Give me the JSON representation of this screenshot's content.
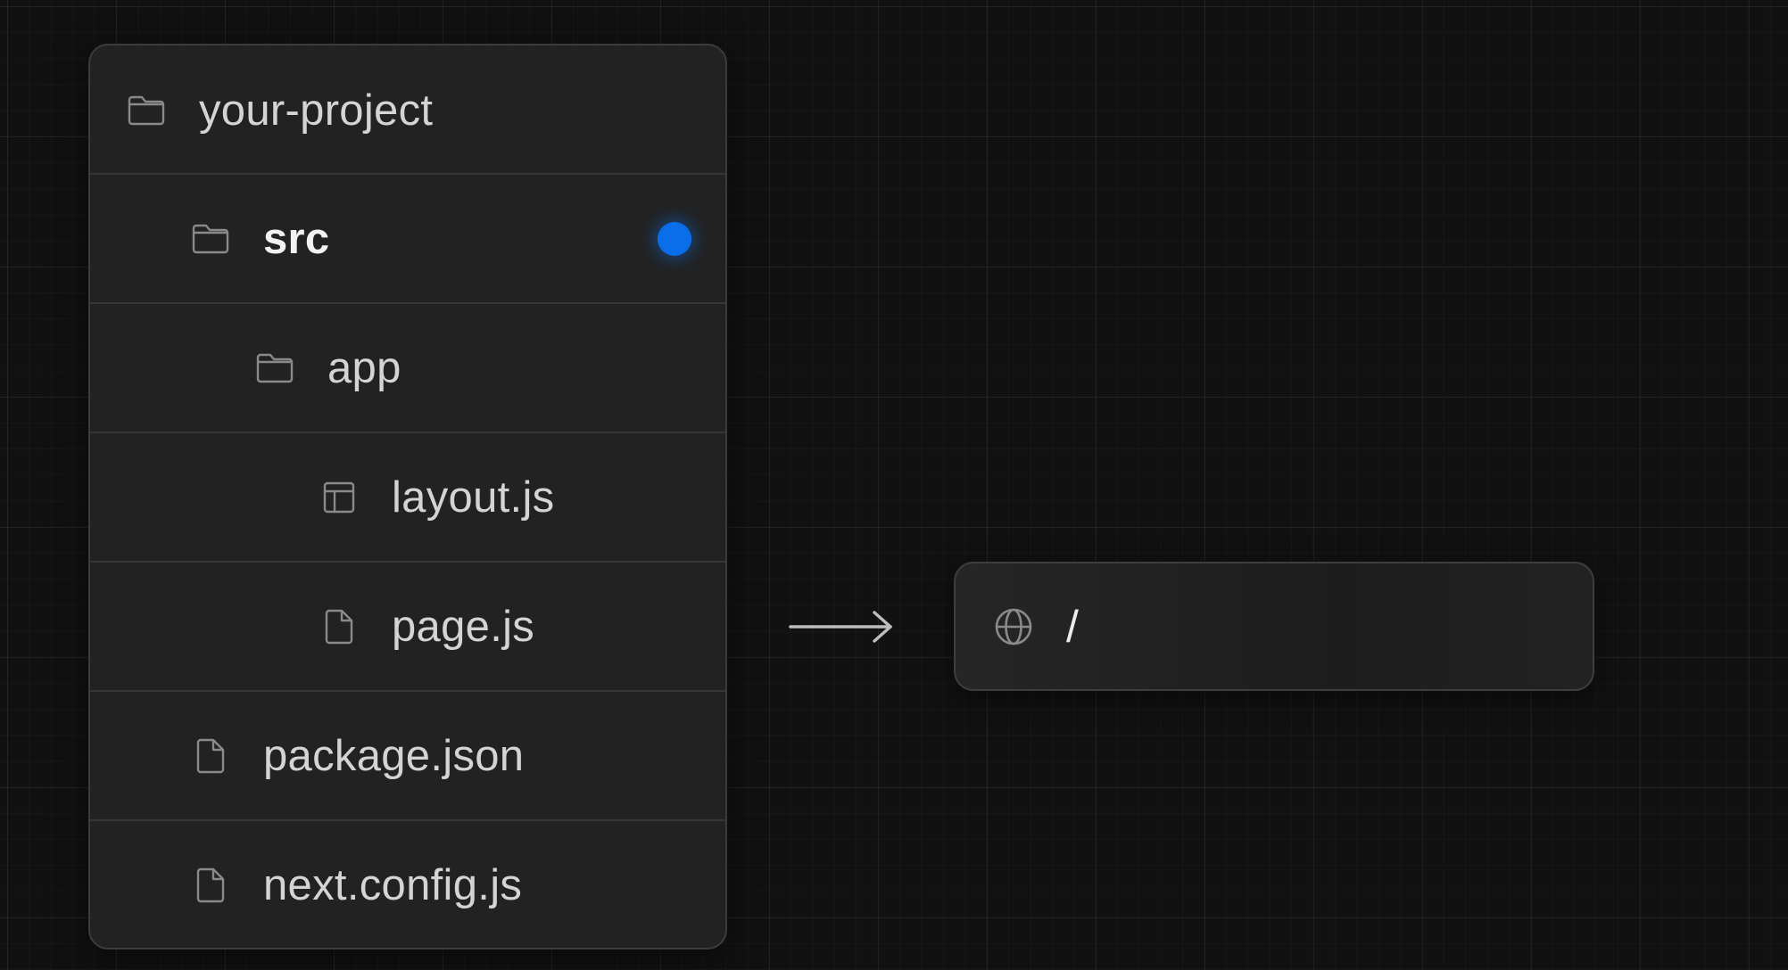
{
  "tree": {
    "items": [
      {
        "label": "your-project",
        "icon": "folder-icon",
        "active": false
      },
      {
        "label": "src",
        "icon": "folder-icon",
        "active": true
      },
      {
        "label": "app",
        "icon": "folder-icon",
        "active": false
      },
      {
        "label": "layout.js",
        "icon": "layout-icon",
        "active": false
      },
      {
        "label": "page.js",
        "icon": "file-icon",
        "active": false
      },
      {
        "label": "package.json",
        "icon": "file-icon",
        "active": false
      },
      {
        "label": "next.config.js",
        "icon": "file-icon",
        "active": false
      }
    ]
  },
  "url": {
    "path": "/",
    "icon": "globe-icon"
  },
  "arrow": {
    "icon": "arrow-right-icon"
  },
  "colors": {
    "background": "#111111",
    "panel": "#222222",
    "accent_dot": "#0a6ee8",
    "text": "#d4d4d4"
  }
}
